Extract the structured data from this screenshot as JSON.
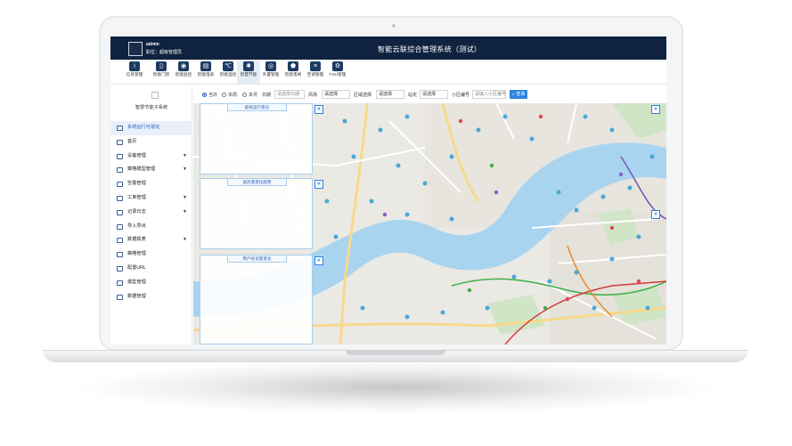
{
  "header": {
    "user_name": "admin",
    "user_role": "职位：超级管理员",
    "title": "智能云联综合管理系统（测试）"
  },
  "toolbar": [
    {
      "label": "信息管理",
      "icon": "info-icon"
    },
    {
      "label": "智能门禁",
      "icon": "door-icon"
    },
    {
      "label": "智能监控",
      "icon": "camera-icon"
    },
    {
      "label": "智能电表",
      "icon": "meter-icon"
    },
    {
      "label": "智能温控",
      "icon": "thermometer-icon"
    },
    {
      "label": "智慧节能",
      "icon": "brain-icon"
    },
    {
      "label": "外置管理",
      "icon": "globe-icon"
    },
    {
      "label": "智能电闸",
      "icon": "shield-icon"
    },
    {
      "label": "空调管理",
      "icon": "aircon-icon"
    },
    {
      "label": "FSU管理",
      "icon": "fsu-icon"
    }
  ],
  "sidebar": {
    "subsystem": "智慧节能子系统",
    "items": [
      {
        "label": "系统运行可视化",
        "expandable": false
      },
      {
        "label": "首页",
        "expandable": false
      },
      {
        "label": "设备管理",
        "expandable": true
      },
      {
        "label": "策略模型管理",
        "expandable": true
      },
      {
        "label": "告警管理",
        "expandable": false
      },
      {
        "label": "工单管理",
        "expandable": true
      },
      {
        "label": "记录日志",
        "expandable": true
      },
      {
        "label": "导入导出",
        "expandable": false
      },
      {
        "label": "数据报表",
        "expandable": true
      },
      {
        "label": "策略管理",
        "expandable": false
      },
      {
        "label": "配置URL",
        "expandable": false
      },
      {
        "label": "模型管理",
        "expandable": false
      },
      {
        "label": "数据管理",
        "expandable": false
      }
    ]
  },
  "filter": {
    "period_options": [
      "当日",
      "本周",
      "本月",
      "日期"
    ],
    "date_placeholder": "请选择日期",
    "region_label": "风场",
    "region_value": "请选择",
    "area_label": "区域选择",
    "area_value": "请选择",
    "station_label": "站定",
    "station_value": "请选择",
    "code_label": "小区编号",
    "code_placeholder": "请输入小区编号",
    "search_button": "查询"
  },
  "panels": [
    {
      "title": "能耗运行变化"
    },
    {
      "title": "送风量变化趋势"
    },
    {
      "title": "用户投诉量变化"
    }
  ],
  "colors": {
    "header_bg": "#0f2340",
    "accent": "#2b84e0",
    "river": "#a8d4f0",
    "panel_border": "#a9cdee"
  }
}
